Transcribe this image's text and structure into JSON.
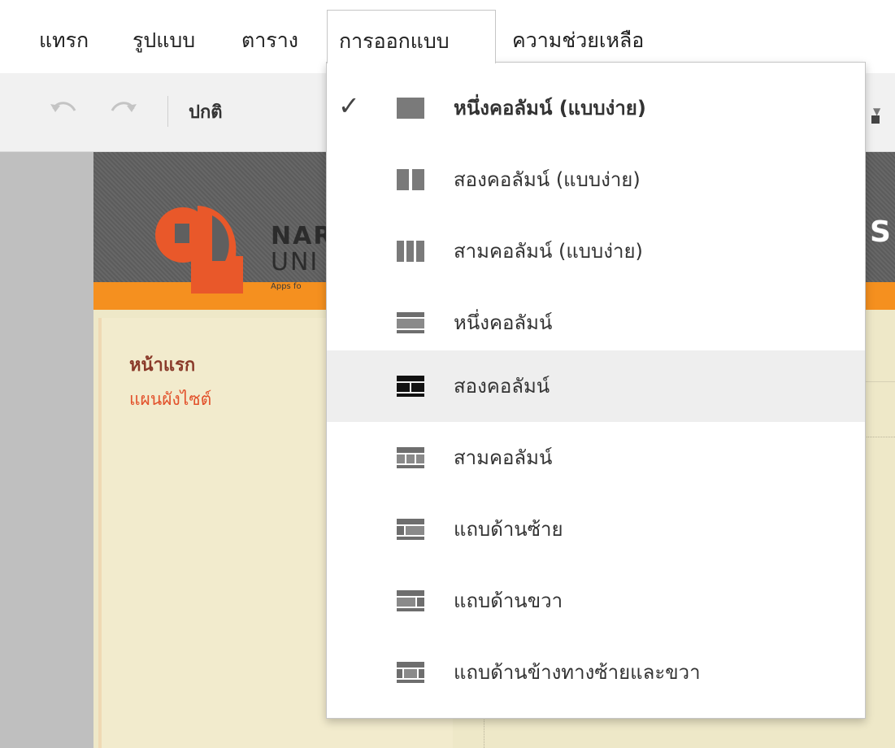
{
  "menubar": {
    "items": [
      {
        "label": "แทรก"
      },
      {
        "label": "รูปแบบ"
      },
      {
        "label": "ตาราง"
      },
      {
        "label": "การออกแบบ"
      },
      {
        "label": "ความช่วยเหลือ"
      }
    ]
  },
  "toolbar": {
    "undo_icon": "undo-icon",
    "redo_icon": "redo-icon",
    "paragraph_style": "ปกติ"
  },
  "site": {
    "logo_line1": "NAR",
    "logo_line2": "UNI",
    "logo_tagline": "Apps fo",
    "header_letter": "S",
    "nav": {
      "home": "หน้าแรก",
      "sitemap": "แผนผังไซต์"
    },
    "colors": {
      "header_stripe": "#f5901f",
      "logo": "#e9582a",
      "background": "#eee8c8"
    }
  },
  "layout_menu": {
    "items": [
      {
        "label": "หนึ่งคอลัมน์ (แบบง่าย)",
        "icon": "one-column-simple-icon",
        "checked": true,
        "bold": true
      },
      {
        "label": "สองคอลัมน์ (แบบง่าย)",
        "icon": "two-column-simple-icon",
        "checked": false
      },
      {
        "label": "สามคอลัมน์ (แบบง่าย)",
        "icon": "three-column-simple-icon",
        "checked": false
      },
      {
        "label": "หนึ่งคอลัมน์",
        "icon": "one-column-icon",
        "checked": false
      },
      {
        "label": "สองคอลัมน์",
        "icon": "two-column-icon",
        "checked": false,
        "highlighted": true
      },
      {
        "label": "สามคอลัมน์",
        "icon": "three-column-icon",
        "checked": false
      },
      {
        "label": "แถบด้านซ้าย",
        "icon": "left-sidebar-icon",
        "checked": false
      },
      {
        "label": "แถบด้านขวา",
        "icon": "right-sidebar-icon",
        "checked": false
      },
      {
        "label": "แถบด้านข้างทางซ้ายและขวา",
        "icon": "left-right-sidebar-icon",
        "checked": false
      }
    ]
  }
}
